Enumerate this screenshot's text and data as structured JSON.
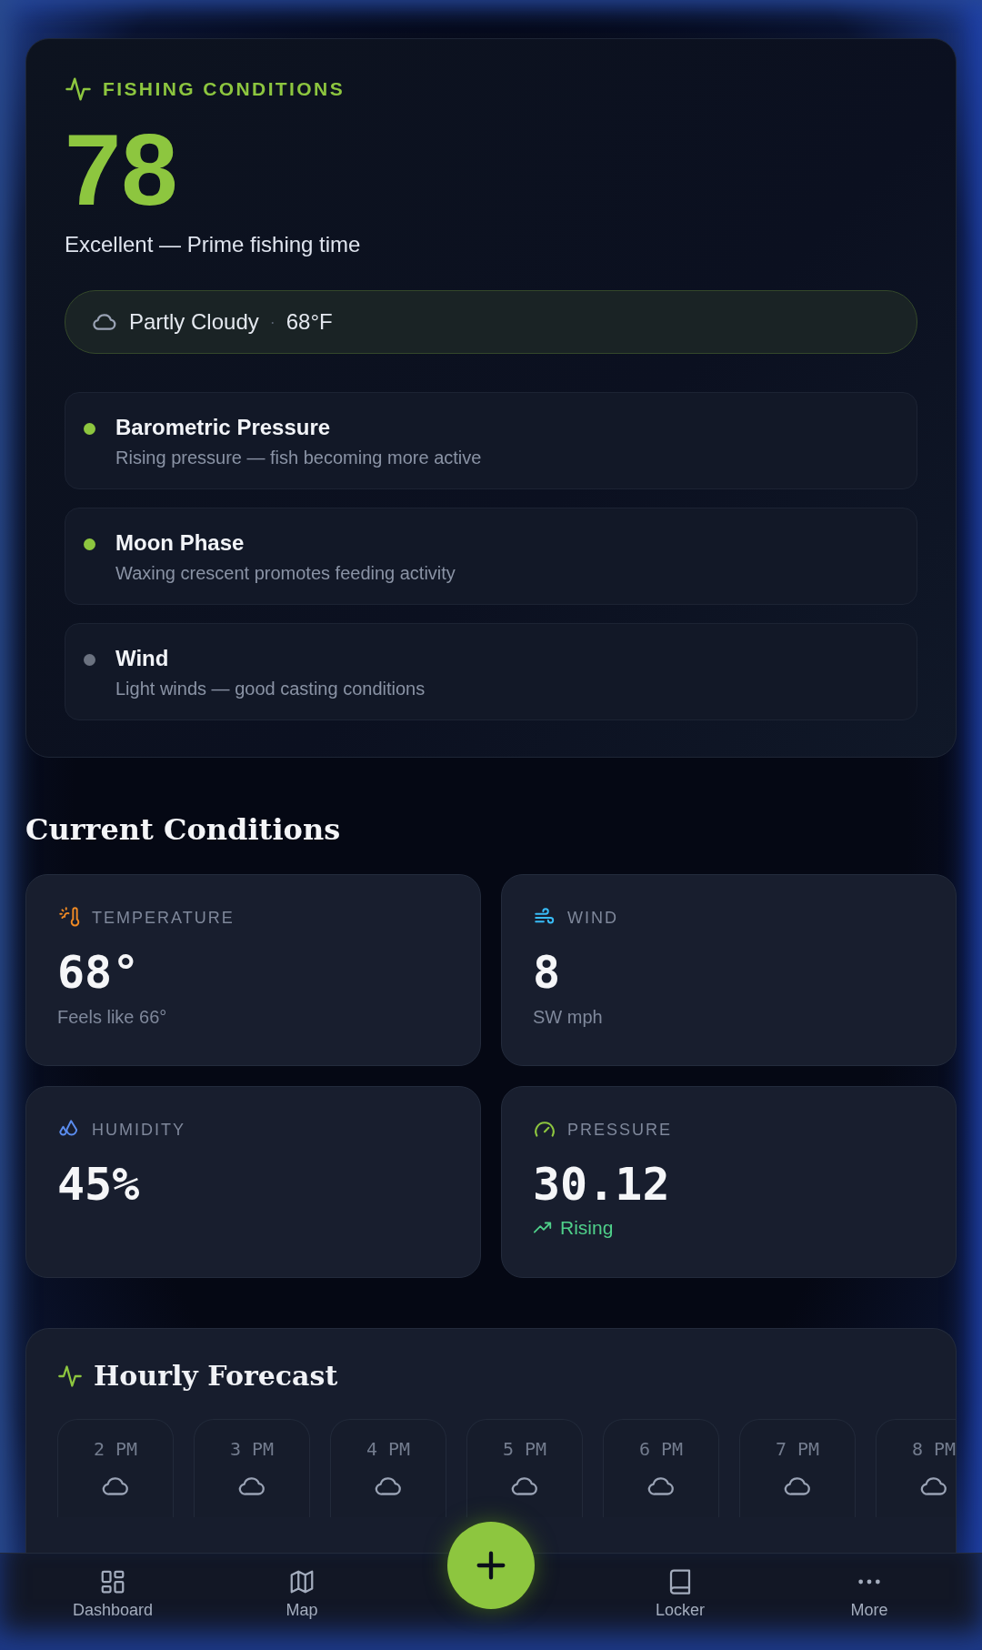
{
  "score_card": {
    "label": "FISHING CONDITIONS",
    "score": "78",
    "summary": "Excellent — Prime fishing time",
    "weather": {
      "condition": "Partly Cloudy",
      "separator": "·",
      "temperature": "68°F"
    },
    "factors": [
      {
        "title": "Barometric Pressure",
        "detail": "Rising pressure — fish becoming more active",
        "color": "#8dc63f"
      },
      {
        "title": "Moon Phase",
        "detail": "Waxing crescent promotes feeding activity",
        "color": "#8dc63f"
      },
      {
        "title": "Wind",
        "detail": "Light winds — good casting conditions",
        "color": "#6b7280"
      }
    ]
  },
  "current_conditions": {
    "heading": "Current Conditions",
    "tiles": [
      {
        "kind": "temperature",
        "label": "TEMPERATURE",
        "value": "68°",
        "note": "Feels like 66°"
      },
      {
        "kind": "wind",
        "label": "WIND",
        "value": "8",
        "note": "SW mph"
      },
      {
        "kind": "humidity",
        "label": "HUMIDITY",
        "value": "45%"
      },
      {
        "kind": "pressure",
        "label": "PRESSURE",
        "value": "30.12",
        "trend": "Rising"
      }
    ]
  },
  "hourly_forecast": {
    "title": "Hourly Forecast",
    "hours": [
      {
        "time": "2 PM"
      },
      {
        "time": "3 PM"
      },
      {
        "time": "4 PM"
      },
      {
        "time": "5 PM"
      },
      {
        "time": "6 PM"
      },
      {
        "time": "7 PM"
      },
      {
        "time": "8 PM"
      }
    ]
  },
  "bottom_nav": {
    "items": [
      {
        "kind": "dashboard",
        "label": "Dashboard"
      },
      {
        "kind": "map",
        "label": "Map"
      },
      {
        "kind": "add"
      },
      {
        "kind": "locker",
        "label": "Locker"
      },
      {
        "kind": "more",
        "label": "More"
      }
    ]
  }
}
